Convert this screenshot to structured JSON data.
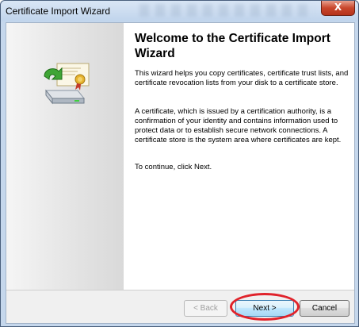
{
  "window": {
    "title": "Certificate Import Wizard",
    "close_glyph": "X"
  },
  "content": {
    "heading": "Welcome to the Certificate Import Wizard",
    "paragraph1": "This wizard helps you copy certificates, certificate trust lists, and certificate revocation lists from your disk to a certificate store.",
    "paragraph2": "A certificate, which is issued by a certification authority, is a confirmation of your identity and contains information used to protect data or to establish secure network connections. A certificate store is the system area where certificates are kept.",
    "paragraph3": "To continue, click Next."
  },
  "footer": {
    "back_label": "< Back",
    "next_label": "Next >",
    "cancel_label": "Cancel"
  },
  "icons": {
    "wizard_graphic": "certificate-import-icon"
  },
  "colors": {
    "highlight": "#e0222a",
    "title_bar": "#c5d7ec"
  }
}
